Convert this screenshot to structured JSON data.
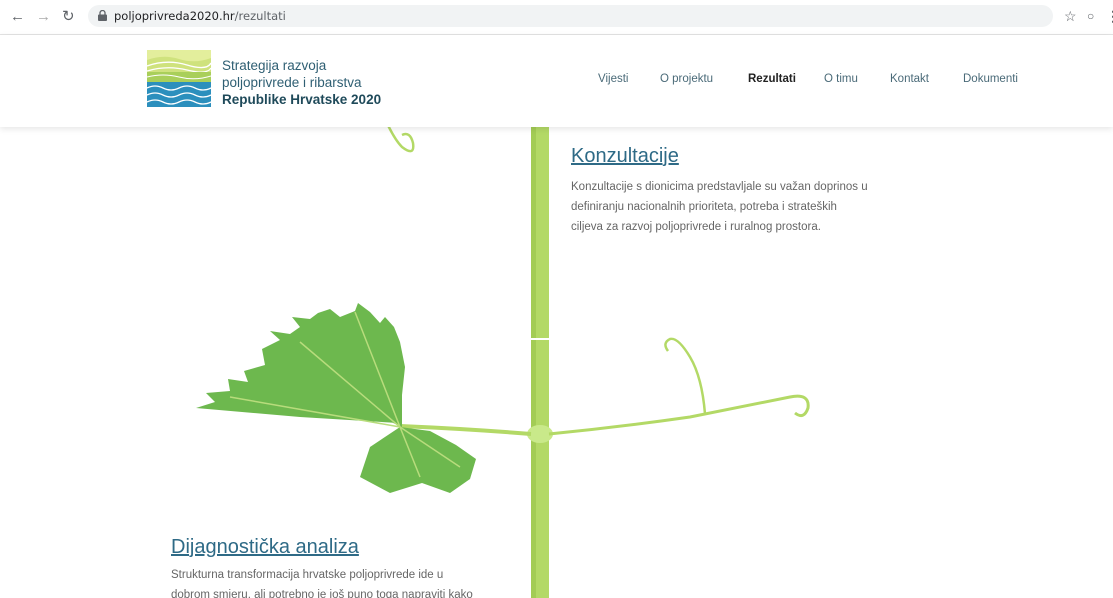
{
  "browser": {
    "url_host": "poljoprivreda2020.hr",
    "url_path": "/rezultati"
  },
  "logo": {
    "line1": "Strategija razvoja",
    "line2": "poljoprivrede i ribarstva",
    "line3": "Republike Hrvatske 2020"
  },
  "nav": {
    "items": [
      {
        "label": "Vijesti"
      },
      {
        "label": "O projektu"
      },
      {
        "label": "Rezultati"
      },
      {
        "label": "O timu"
      },
      {
        "label": "Kontakt"
      },
      {
        "label": "Dokumenti"
      }
    ],
    "active": "Rezultati"
  },
  "sections": [
    {
      "title": "Konzultacije",
      "lines": [
        "Konzultacije s dionicima predstavljale su važan doprinos u",
        "definiranju nacionalnih prioriteta, potreba i strateških",
        "ciljeva za razvoj poljoprivrede i ruralnog prostora."
      ]
    },
    {
      "title": "Dijagnostička analiza",
      "lines": [
        "Strukturna transformacija hrvatske poljoprivrede ide u",
        "dobrom smjeru, ali potrebno je još puno toga napraviti kako"
      ]
    }
  ],
  "colors": {
    "accent": "#2e6a86",
    "vine": "#b3d966",
    "leaf": "#6db84e"
  }
}
